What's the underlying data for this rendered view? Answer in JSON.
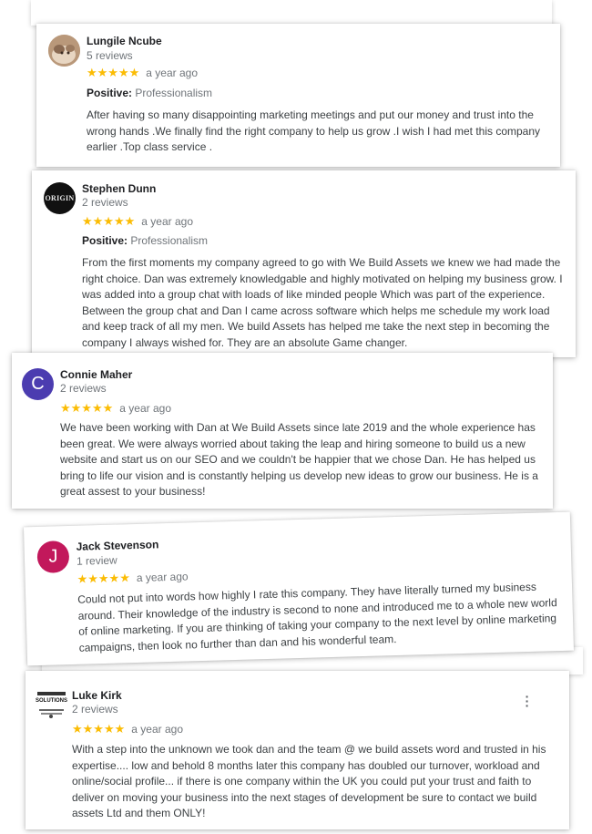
{
  "reviews": [
    {
      "name": "Lungile Ncube",
      "count": "5 reviews",
      "stars": "★★★★★",
      "ago": "a year ago",
      "positive_label": "Positive:",
      "positive_value": "Professionalism",
      "text": "After having so many disappointing marketing meetings and put our money and trust into the wrong hands .We finally find the right company to help us grow .I wish I had met  this company earlier .Top class service .",
      "avatar_icon": "cat-photo-avatar"
    },
    {
      "name": "Stephen Dunn",
      "count": "2 reviews",
      "stars": "★★★★★",
      "ago": "a year ago",
      "positive_label": "Positive:",
      "positive_value": "Professionalism",
      "text": "From the first moments my company agreed to go with We Build Assets we knew we had made the right choice. Dan was extremely knowledgable and highly motivated on helping my business grow. I was added into a group chat with loads of like minded people Which was part of the experience. Between the group chat and Dan I came across software which helps me schedule my work load and keep track of all my men. We build Assets has helped me take the next step in becoming the company I always wished for. They are an absolute Game changer.",
      "avatar_text": "ORIGIN"
    },
    {
      "name": "Connie Maher",
      "count": "2 reviews",
      "stars": "★★★★★",
      "ago": "a year ago",
      "text": "We have been working with Dan at We Build Assets since late 2019 and the whole experience has been great. We were always worried about taking the leap and hiring someone to build us a new website and start us on our SEO and we couldn't be happier that we chose Dan. He has helped us bring to life our vision and is constantly helping us develop new ideas to grow our business. He is a great assest to your business!",
      "avatar_letter": "C",
      "avatar_color": "#4b3cb0"
    },
    {
      "name": "Jack Stevenson",
      "count": "1 review",
      "stars": "★★★★★",
      "ago": "a year ago",
      "text": "Could not put into words how highly I rate this company. They have literally turned my business around. Their knowledge of the industry is second to none and introduced me to a whole new world of online marketing. If you are thinking of taking your company to the next level by online marketing campaigns, then look no further than dan and his wonderful team.",
      "avatar_letter": "J",
      "avatar_color": "#c2185b"
    },
    {
      "name": "Luke Kirk",
      "count": "2 reviews",
      "stars": "★★★★★",
      "ago": "a year ago",
      "text": "With a step into the unknown we took dan and the team @ we build assets word and trusted in his expertise.... low and behold 8 months later this company has doubled our turnover, workload and online/social profile... if there is one company within the UK you could put your trust and faith to deliver on moving your business into the next stages of development be sure to contact we build assets Ltd and them ONLY!",
      "avatar_text": "SOLUTIONS",
      "more_icon": "more-vert-icon"
    }
  ]
}
